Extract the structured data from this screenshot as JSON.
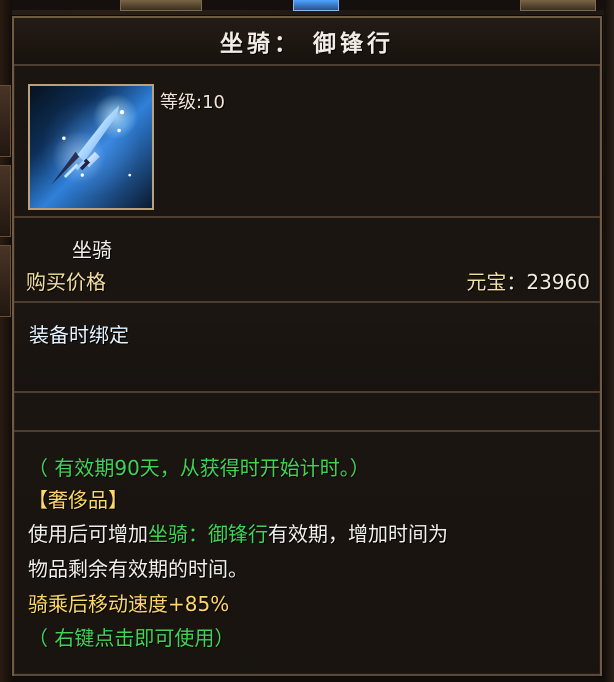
{
  "title": "坐骑： 御锋行",
  "level": {
    "label": "等级",
    "separator": ":",
    "value": "10"
  },
  "type_text": "坐骑",
  "price": {
    "label": "购买价格",
    "currency_label": "元宝",
    "separator": "：",
    "value": "23960"
  },
  "bind_text": "装备时绑定",
  "details": {
    "line1": "（ 有效期90天，从获得时开始计时。）",
    "line2": "【奢侈品】",
    "line3_prefix": "使用后可增加",
    "line3_highlight": "坐骑：御锋行",
    "line3_suffix": "有效期，增加时间为",
    "line4": "物品剩余有效期的时间。",
    "line5": "骑乘后移动速度+85%",
    "line6": "（ 右键点击即可使用）"
  },
  "icons": {
    "item_icon": "sword-mount-icon"
  },
  "colors": {
    "title": "#f3ece6",
    "gold": "#ffd76a",
    "green": "#41d454",
    "white": "#f2f0ea",
    "bind": "#e4f3ff",
    "border": "#6f5a43"
  }
}
